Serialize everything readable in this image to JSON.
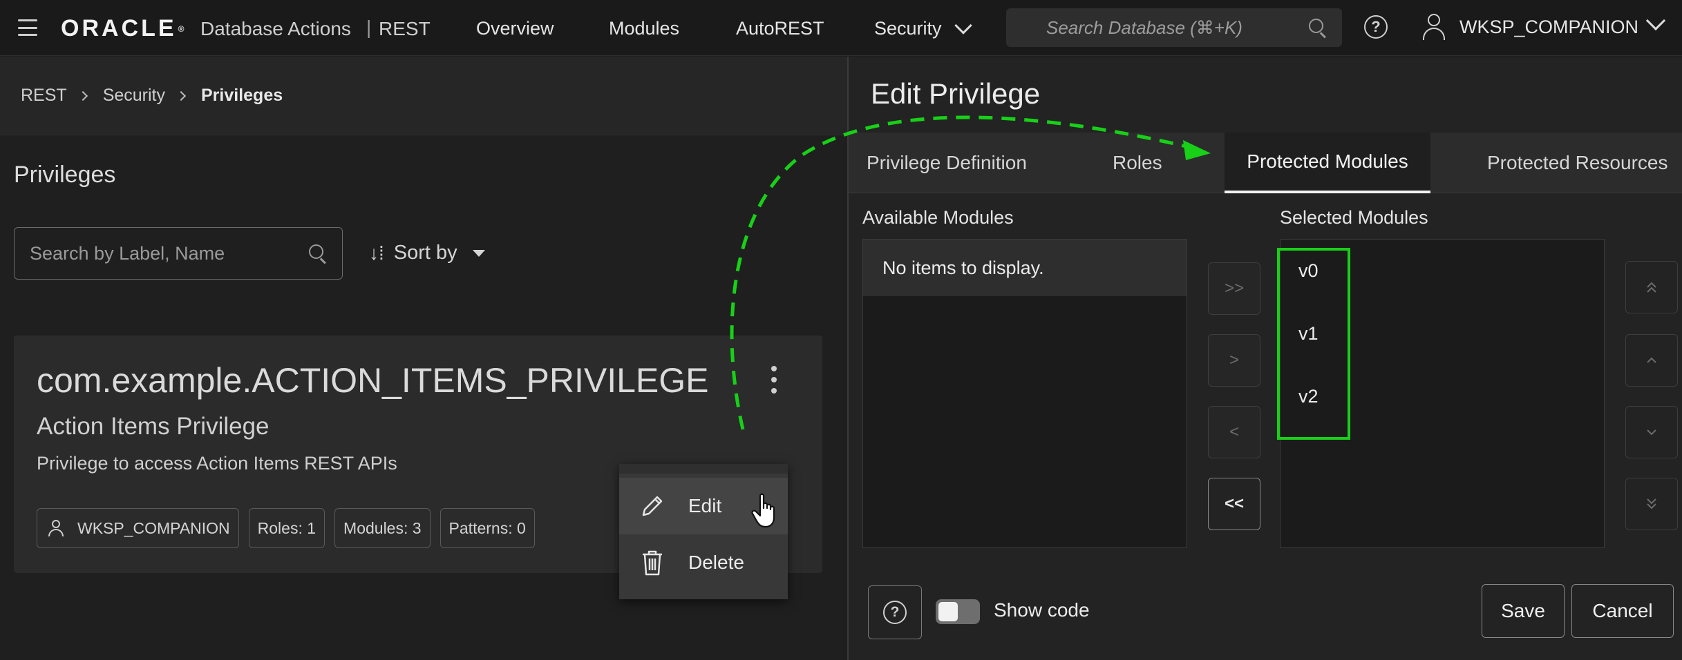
{
  "topbar": {
    "logo": "ORACLE",
    "logo_mark": "®",
    "app_name": "Database Actions",
    "app_separator": "|",
    "app_section": "REST",
    "nav": [
      "Overview",
      "Modules",
      "AutoREST",
      "Security"
    ],
    "search_placeholder": "Search Database (⌘+K)",
    "help": "?",
    "user": "WKSP_COMPANION"
  },
  "breadcrumb": [
    "REST",
    "Security",
    "Privileges"
  ],
  "page": {
    "title": "Privileges",
    "search_placeholder": "Search by Label, Name",
    "sort_label": "Sort by",
    "sort_icon": "↓",
    "sort_icon2": "⁞"
  },
  "card": {
    "name": "com.example.ACTION_ITEMS_PRIVILEGE",
    "label": "Action Items Privilege",
    "description": "Privilege to access Action Items REST APIs",
    "chips": {
      "owner": "WKSP_COMPANION",
      "roles": "Roles: 1",
      "modules": "Modules: 3",
      "patterns": "Patterns: 0"
    }
  },
  "context_menu": {
    "edit": "Edit",
    "delete": "Delete"
  },
  "dialog": {
    "title": "Edit Privilege",
    "tabs": [
      "Privilege Definition",
      "Roles",
      "Protected Modules",
      "Protected Resources"
    ],
    "active_tab": "Protected Modules",
    "available_label": "Available Modules",
    "no_items": "No items to display.",
    "selected_label": "Selected Modules",
    "selected_items": [
      "v0",
      "v1",
      "v2"
    ],
    "transfer_buttons": [
      ">>",
      ">",
      "<",
      "<<"
    ],
    "order_buttons": [
      "move-top",
      "move-up",
      "move-down",
      "move-bottom"
    ],
    "help": "?",
    "show_code_label": "Show code",
    "show_code_on": false,
    "save_label": "Save",
    "cancel_label": "Cancel"
  },
  "colors": {
    "annotation": "#18d018",
    "background": "#1e1e1e"
  }
}
